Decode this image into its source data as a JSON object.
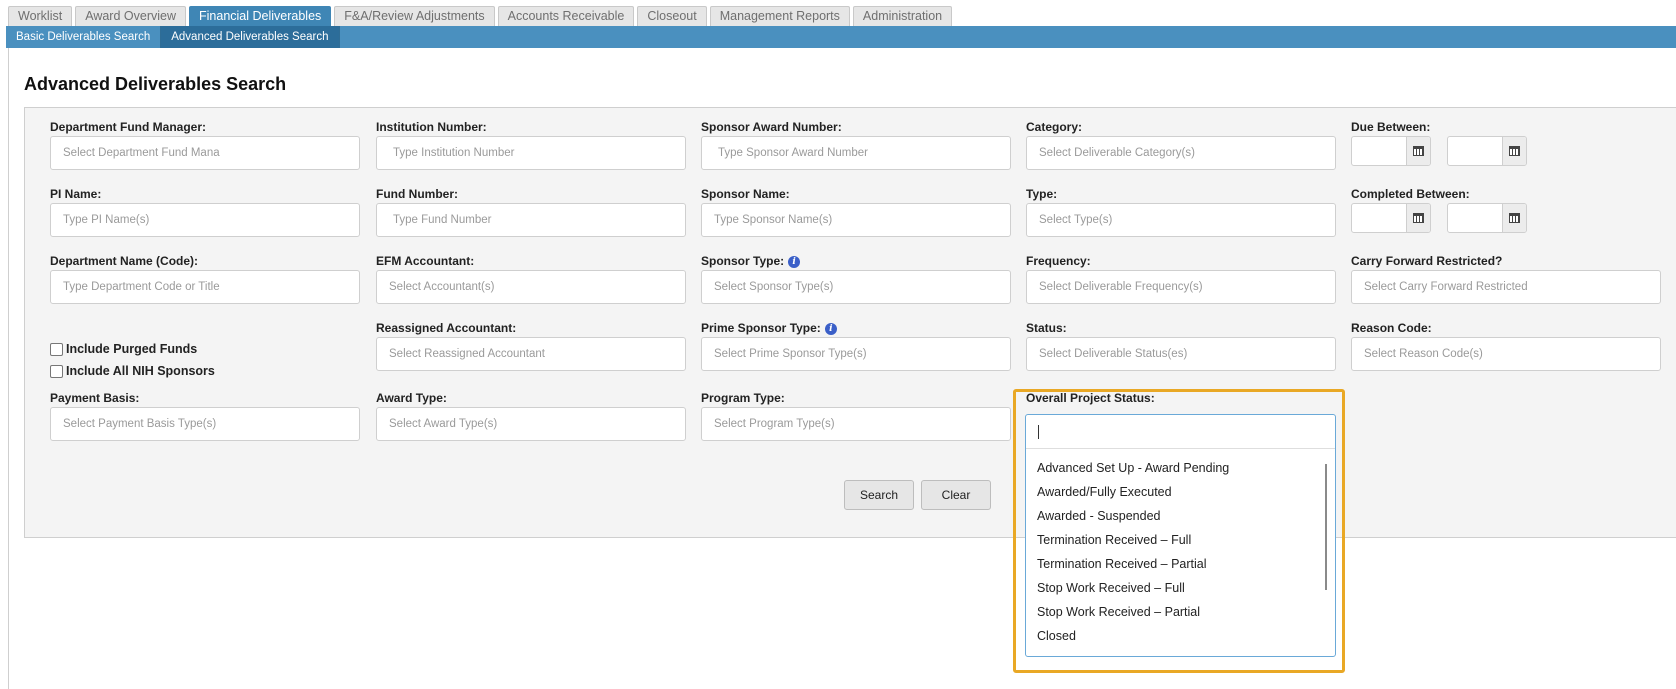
{
  "tabs": [
    "Worklist",
    "Award Overview",
    "Financial Deliverables",
    "F&A/Review Adjustments",
    "Accounts Receivable",
    "Closeout",
    "Management Reports",
    "Administration"
  ],
  "subnav": [
    "Basic Deliverables Search",
    "Advanced Deliverables Search"
  ],
  "page_title": "Advanced Deliverables Search",
  "fields": {
    "dept_fund_manager": {
      "label": "Department Fund Manager:",
      "placeholder": "Select Department Fund Mana"
    },
    "institution_number": {
      "label": "Institution Number:",
      "placeholder": "Type Institution Number"
    },
    "sponsor_award_number": {
      "label": "Sponsor Award Number:",
      "placeholder": "Type Sponsor Award Number"
    },
    "category": {
      "label": "Category:",
      "placeholder": "Select Deliverable Category(s)"
    },
    "due_between": {
      "label": "Due Between:"
    },
    "pi_name": {
      "label": "PI Name:",
      "placeholder": "Type PI Name(s)"
    },
    "fund_number": {
      "label": "Fund Number:",
      "placeholder": "Type Fund Number"
    },
    "sponsor_name": {
      "label": "Sponsor Name:",
      "placeholder": "Type Sponsor Name(s)"
    },
    "type": {
      "label": "Type:",
      "placeholder": "Select Type(s)"
    },
    "completed_between": {
      "label": "Completed Between:"
    },
    "department_name": {
      "label": "Department Name (Code):",
      "placeholder": "Type Department Code or Title"
    },
    "efm_accountant": {
      "label": "EFM Accountant:",
      "placeholder": "Select Accountant(s)"
    },
    "sponsor_type": {
      "label": "Sponsor Type:",
      "placeholder": "Select Sponsor Type(s)"
    },
    "frequency": {
      "label": "Frequency:",
      "placeholder": "Select Deliverable Frequency(s)"
    },
    "carry_forward": {
      "label": "Carry Forward Restricted?",
      "placeholder": "Select Carry Forward Restricted"
    },
    "reassigned_accountant": {
      "label": "Reassigned Accountant:",
      "placeholder": "Select Reassigned Accountant"
    },
    "prime_sponsor_type": {
      "label": "Prime Sponsor Type:",
      "placeholder": "Select Prime Sponsor Type(s)"
    },
    "status": {
      "label": "Status:",
      "placeholder": "Select Deliverable Status(es)"
    },
    "reason_code": {
      "label": "Reason Code:",
      "placeholder": "Select Reason Code(s)"
    },
    "payment_basis": {
      "label": "Payment Basis:",
      "placeholder": "Select Payment Basis Type(s)"
    },
    "award_type": {
      "label": "Award Type:",
      "placeholder": "Select Award Type(s)"
    },
    "program_type": {
      "label": "Program Type:",
      "placeholder": "Select Program Type(s)"
    },
    "overall_project_status": {
      "label": "Overall Project Status:"
    }
  },
  "checkboxes": {
    "include_purged": "Include Purged Funds",
    "include_nih": "Include All NIH Sponsors"
  },
  "buttons": {
    "search": "Search",
    "clear": "Clear"
  },
  "status_options": [
    "Advanced Set Up - Award Pending",
    "Awarded/Fully Executed",
    "Awarded - Suspended",
    "Termination Received – Full",
    "Termination Received – Partial",
    "Stop Work Received – Full",
    "Stop Work Received – Partial",
    "Closed"
  ]
}
